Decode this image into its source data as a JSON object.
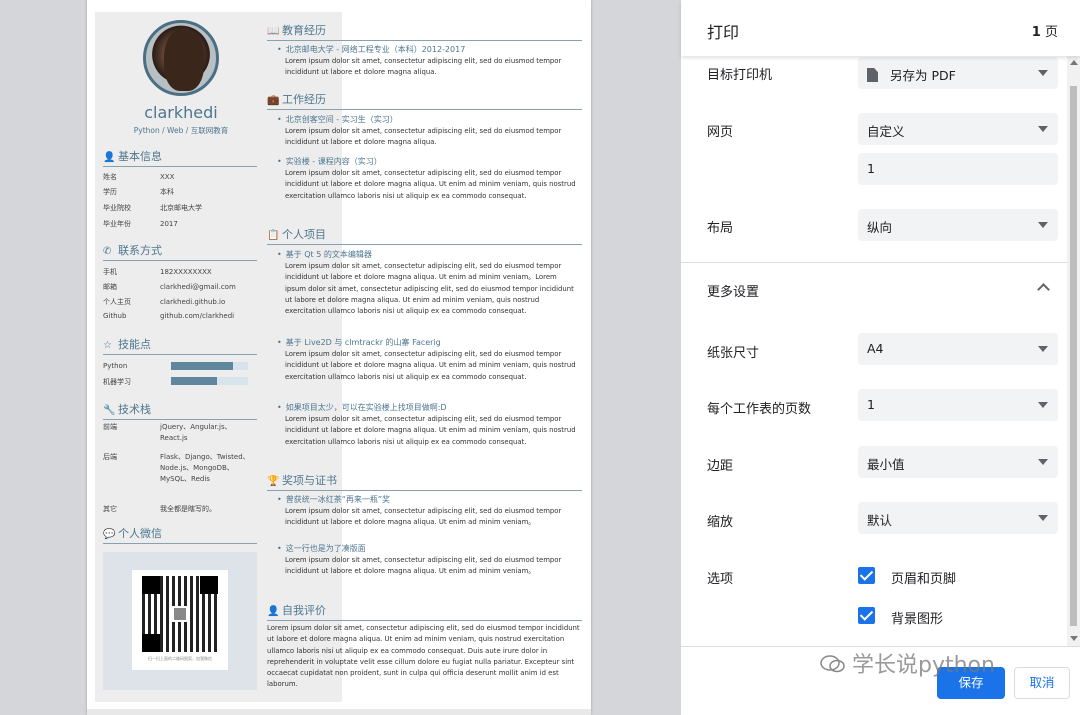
{
  "resume": {
    "name": "clarkhedi",
    "tagline": "Python / Web / 互联网教育",
    "basic": {
      "title": "基本信息",
      "rows": [
        {
          "k": "姓名",
          "v": "XXX"
        },
        {
          "k": "学历",
          "v": "本科"
        },
        {
          "k": "毕业院校",
          "v": "北京邮电大学"
        },
        {
          "k": "毕业年份",
          "v": "2017"
        }
      ]
    },
    "contact": {
      "title": "联系方式",
      "rows": [
        {
          "k": "手机",
          "v": "182XXXXXXXX"
        },
        {
          "k": "邮箱",
          "v": "clarkhedi@gmail.com"
        },
        {
          "k": "个人主页",
          "v": "clarkhedi.github.io"
        },
        {
          "k": "Github",
          "v": "github.com/clarkhedi"
        }
      ]
    },
    "skills": {
      "title": "技能点",
      "items": [
        {
          "k": "Python",
          "level": 0.8
        },
        {
          "k": "机器学习",
          "level": 0.6
        }
      ]
    },
    "tech": {
      "title": "技术栈",
      "rows": [
        {
          "k": "前端",
          "v": "jQuery、Angular.js、React.js"
        },
        {
          "k": "后端",
          "v": "Flask、Django、Twisted、Node.js、MongoDB、MySQL、Redis"
        },
        {
          "k": "其它",
          "v": "我全都是瞎写的。"
        }
      ]
    },
    "wechat": {
      "title": "个人微信",
      "caption": "扫一扫上面的二维码图案，加我微信"
    },
    "education": {
      "title": "教育经历",
      "items": [
        {
          "h": "北京邮电大学 - 网络工程专业（本科）2012-2017",
          "p": "Lorem ipsum dolor sit amet, consectetur adipiscing elit, sed do eiusmod tempor incididunt ut labore et dolore magna aliqua."
        }
      ]
    },
    "work": {
      "title": "工作经历",
      "items": [
        {
          "h": "北京创客空间 - 实习生（实习）",
          "p": "Lorem ipsum dolor sit amet, consectetur adipiscing elit, sed do eiusmod tempor incididunt ut labore et dolore magna aliqua."
        },
        {
          "h": "实验楼 - 课程内容（实习）",
          "p": "Lorem ipsum dolor sit amet, consectetur adipiscing elit, sed do eiusmod tempor incididunt ut labore et dolore magna aliqua. Ut enim ad minim veniam, quis nostrud exercitation ullamco laboris nisi ut aliquip ex ea commodo consequat."
        }
      ]
    },
    "projects": {
      "title": "个人项目",
      "items": [
        {
          "h": "基于 Qt 5 的文本编辑器",
          "p": "Lorem ipsum dolor sit amet, consectetur adipiscing elit, sed do eiusmod tempor incididunt ut labore et dolore magna aliqua. Ut enim ad minim veniam。Lorem ipsum dolor sit amet, consectetur adipiscing elit, sed do eiusmod tempor incididunt ut labore et dolore magna aliqua. Ut enim ad minim veniam, quis nostrud exercitation ullamco laboris nisi ut aliquip ex ea commodo consequat."
        },
        {
          "h": "基于 Live2D 与 clmtrackr 的山寨 Facerig",
          "p": "Lorem ipsum dolor sit amet, consectetur adipiscing elit, sed do eiusmod tempor incididunt ut labore et dolore magna aliqua. Ut enim ad minim veniam, quis nostrud exercitation ullamco laboris nisi ut aliquip ex ea commodo consequat."
        },
        {
          "h": "如果项目太少，可以在实验楼上找项目做啊:D",
          "p": "Lorem ipsum dolor sit amet, consectetur adipiscing elit, sed do eiusmod tempor incididunt ut labore et dolore magna aliqua. Ut enim ad minim veniam, quis nostrud exercitation ullamco laboris nisi ut aliquip ex ea commodo consequat."
        }
      ]
    },
    "awards": {
      "title": "奖项与证书",
      "items": [
        {
          "h": "曾获统一冰红茶“再来一瓶”奖",
          "p": "Lorem ipsum dolor sit amet, consectetur adipiscing elit, sed do eiusmod tempor incididunt ut labore et dolore magna aliqua. Ut enim ad minim veniam。"
        },
        {
          "h": "这一行也是为了凑版面",
          "p": "Lorem ipsum dolor sit amet, consectetur adipiscing elit, sed do eiusmod tempor incididunt ut labore et dolore magna aliqua. Ut enim ad minim veniam。"
        }
      ]
    },
    "self": {
      "title": "自我评价",
      "p": "Lorem ipsum dolor sit amet, consectetur adipiscing elit, sed do eiusmod tempor incididunt ut labore et dolore magna aliqua. Ut enim ad minim veniam, quis nostrud exercitation ullamco laboris nisi ut aliquip ex ea commodo consequat. Duis aute irure dolor in reprehenderit in voluptate velit esse cillum dolore eu fugiat nulla pariatur. Excepteur sint occaecat cupidatat non proident, sunt in culpa qui officia deserunt mollit anim id est laborum."
    }
  },
  "print": {
    "title": "打印",
    "page_count": "1",
    "page_unit": "页",
    "destination": {
      "label": "目标打印机",
      "value": "另存为 PDF"
    },
    "pages": {
      "label": "网页",
      "value": "自定义",
      "custom": "1"
    },
    "layout": {
      "label": "布局",
      "value": "纵向"
    },
    "more": {
      "label": "更多设置"
    },
    "paper": {
      "label": "纸张尺寸",
      "value": "A4"
    },
    "per_sheet": {
      "label": "每个工作表的页数",
      "value": "1"
    },
    "margins": {
      "label": "边距",
      "value": "最小值"
    },
    "scale": {
      "label": "缩放",
      "value": "默认"
    },
    "options": {
      "label": "选项",
      "headers": "页眉和页脚",
      "background": "背景图形"
    },
    "save": "保存",
    "cancel": "取消"
  },
  "watermark": "学长说python",
  "colors": {
    "accent": "#1a73e8",
    "resume_accent": "#4d7690"
  }
}
